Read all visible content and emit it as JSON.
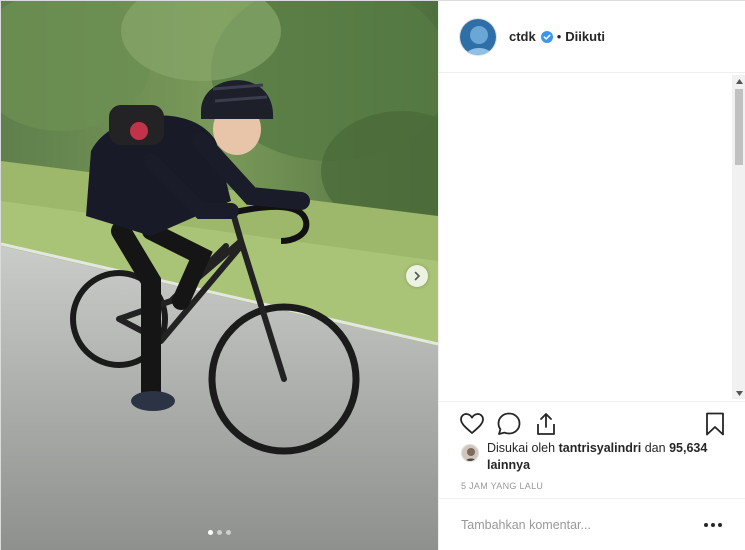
{
  "post": {
    "username": "ctdk",
    "follow_separator": "•",
    "follow_status": "Diikuti",
    "verified": true
  },
  "media": {
    "carousel_count": 3,
    "carousel_active_index": 0,
    "next_icon": "chevron-right-icon"
  },
  "actions": {
    "like_icon": "heart-icon",
    "comment_icon": "comment-icon",
    "share_icon": "share-icon",
    "save_icon": "bookmark-icon"
  },
  "likes": {
    "prefix": "Disukai oleh",
    "user": "tantrisyalindri",
    "conjunction": "dan",
    "count": "95,634",
    "suffix": "lainnya"
  },
  "timestamp": "5 JAM YANG LALU",
  "comment_box": {
    "placeholder": "Tambahkan komentar...",
    "more_icon": "more-options-icon"
  },
  "colors": {
    "verified_blue": "#3897f0",
    "text": "#262626",
    "muted": "#999999",
    "border": "#efefef"
  }
}
